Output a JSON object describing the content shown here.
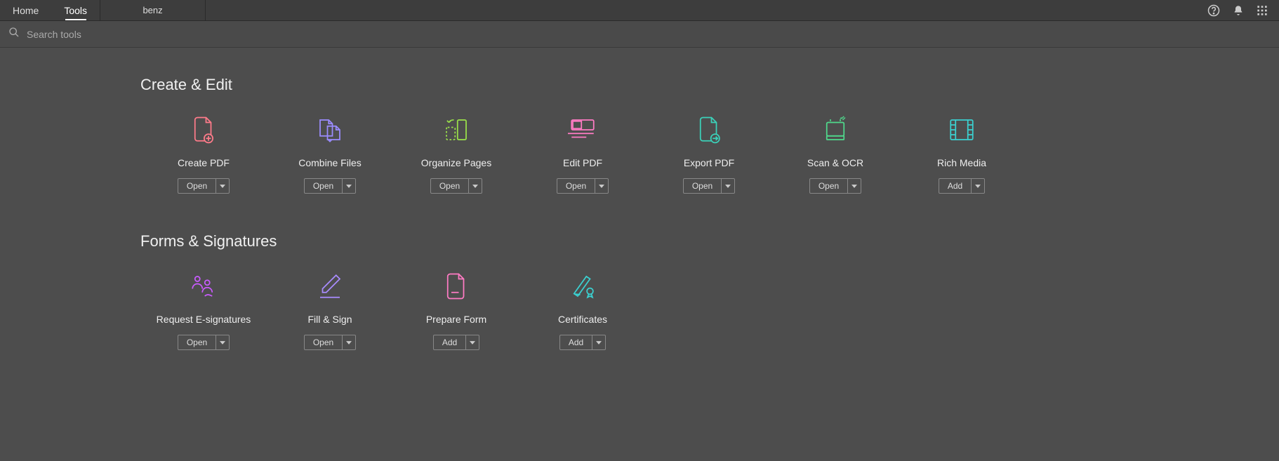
{
  "topbar": {
    "home": "Home",
    "tools": "Tools",
    "doc_tab": "benz"
  },
  "search": {
    "placeholder": "Search tools"
  },
  "sections": {
    "create_edit": {
      "title": "Create & Edit",
      "tools": {
        "create_pdf": {
          "label": "Create PDF",
          "button": "Open"
        },
        "combine_files": {
          "label": "Combine Files",
          "button": "Open"
        },
        "organize_pages": {
          "label": "Organize Pages",
          "button": "Open"
        },
        "edit_pdf": {
          "label": "Edit PDF",
          "button": "Open"
        },
        "export_pdf": {
          "label": "Export PDF",
          "button": "Open"
        },
        "scan_ocr": {
          "label": "Scan & OCR",
          "button": "Open"
        },
        "rich_media": {
          "label": "Rich Media",
          "button": "Add"
        }
      }
    },
    "forms_signatures": {
      "title": "Forms & Signatures",
      "tools": {
        "request_esign": {
          "label": "Request E-signatures",
          "button": "Open"
        },
        "fill_sign": {
          "label": "Fill & Sign",
          "button": "Open"
        },
        "prepare_form": {
          "label": "Prepare Form",
          "button": "Add"
        },
        "certificates": {
          "label": "Certificates",
          "button": "Add"
        }
      }
    }
  }
}
